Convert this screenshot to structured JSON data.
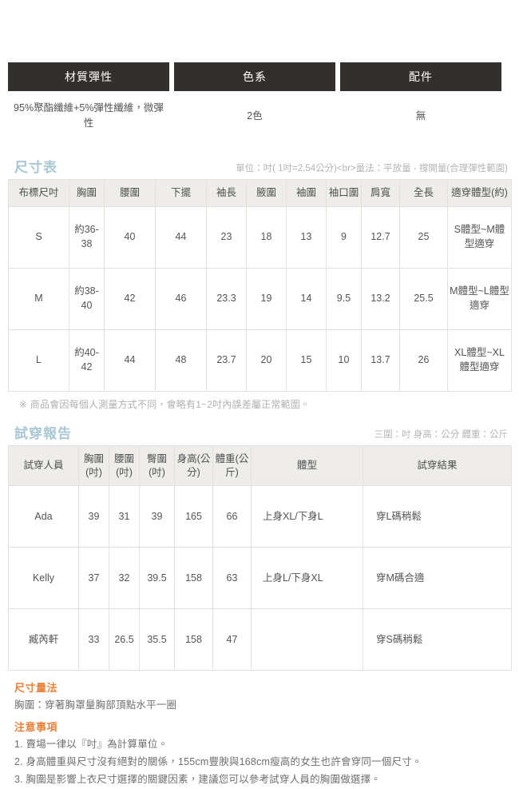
{
  "spec_table": {
    "headers": [
      "材質彈性",
      "色系",
      "配件"
    ],
    "values": [
      "95%聚酯纖維+5%彈性纖維，微彈性",
      "2色",
      "無"
    ]
  },
  "size_section": {
    "title": "尺寸表",
    "note": "單位：吋( 1吋=2.54公分)<br>量法：平放量 - 撐開量(合理彈性範圍)",
    "headers": [
      "布標尺吋",
      "胸圍",
      "腰圍",
      "下擺",
      "袖長",
      "腋圍",
      "袖圍",
      "袖口圍",
      "肩寬",
      "全長",
      "適穿體型(約)"
    ],
    "rows": [
      {
        "size": "S",
        "bust": "約36-38",
        "waist": "40",
        "hem": "44",
        "sleeve_length": "23",
        "armpit": "18",
        "sleeve": "13",
        "cuff": "9",
        "shoulder": "12.7",
        "total_length": "25",
        "fit": "S體型~M體型適穿"
      },
      {
        "size": "M",
        "bust": "約38-40",
        "waist": "42",
        "hem": "46",
        "sleeve_length": "23.3",
        "armpit": "19",
        "sleeve": "14",
        "cuff": "9.5",
        "shoulder": "13.2",
        "total_length": "25.5",
        "fit": "M體型~L體型適穿"
      },
      {
        "size": "L",
        "bust": "約40-42",
        "waist": "44",
        "hem": "48",
        "sleeve_length": "23.7",
        "armpit": "20",
        "sleeve": "15",
        "cuff": "10",
        "shoulder": "13.7",
        "total_length": "26",
        "fit": "XL體型~XL體型適穿"
      }
    ],
    "remark": "※ 商品會因每個人測量方式不同，會略有1~2吋內誤差屬正常範圍。"
  },
  "fit_section": {
    "title": "試穿報告",
    "note": "三圍：吋 身高：公分 體重：公斤",
    "headers": [
      "試穿人員",
      "胸圍(吋)",
      "腰圍(吋)",
      "臀圍(吋)",
      "身高(公分)",
      "體重(公斤)",
      "體型",
      "試穿結果"
    ],
    "rows": [
      {
        "name": "Ada",
        "bust": "39",
        "waist": "31",
        "hip": "39",
        "height": "165",
        "weight": "66",
        "body_type": "上身XL/下身L",
        "result": "穿L碼稍鬆"
      },
      {
        "name": "Kelly",
        "bust": "37",
        "waist": "32",
        "hip": "39.5",
        "height": "158",
        "weight": "63",
        "body_type": "上身L/下身XL",
        "result": "穿M碼合適"
      },
      {
        "name": "臧芮軒",
        "bust": "33",
        "waist": "26.5",
        "hip": "35.5",
        "height": "158",
        "weight": "47",
        "body_type": "",
        "result": "穿S碼稍鬆"
      }
    ]
  },
  "measure_notes": {
    "title": "尺寸量法",
    "lines": [
      "胸圍：穿著胸罩量胸部頂點水平一圈"
    ]
  },
  "caution_notes": {
    "title": "注意事項",
    "lines": [
      "1. 賣場一律以『吋』為計算單位。",
      "2. 身高體重與尺寸沒有絕對的關係，155cm豐腴與168cm瘦高的女生也許會穿同一個尺寸。",
      "3. 胸圍是影響上衣尺寸選擇的關鍵因素，建議您可以參考試穿人員的胸圍做選擇。"
    ]
  },
  "colors": {
    "header_dark": "#332f2c",
    "accent_blue": "#a9cfdb",
    "accent_orange": "#e8823a",
    "grid_border": "#e3e1dc",
    "grid_head_bg": "#eeedea"
  }
}
